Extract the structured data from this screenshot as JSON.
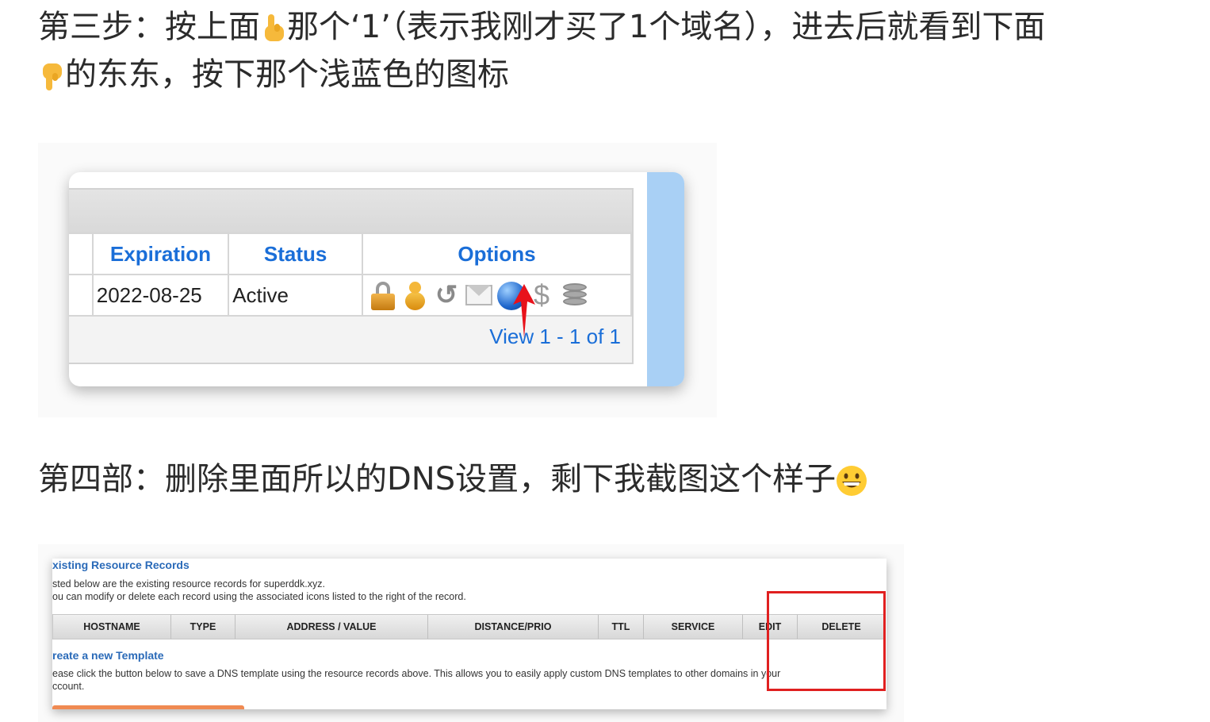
{
  "step3": {
    "part1": "第三步：按上面",
    "part2": "那个‘1’（表示我刚才买了1个域名），进去后就看到下面",
    "part3": "的东东，按下那个浅蓝色的图标"
  },
  "step4": {
    "text": "第四部：删除里面所以的DNS设置，剩下我截图这个样子"
  },
  "screenshot1": {
    "headers": [
      "Expiration",
      "Status",
      "Options"
    ],
    "row": {
      "expiration": "2022-08-25",
      "status": "Active"
    },
    "icons": [
      "lock-icon",
      "user-icon",
      "return-icon",
      "mail-icon",
      "globe-icon",
      "dollar-icon",
      "database-icon"
    ],
    "dollar_glyph": "$",
    "return_glyph": "↺",
    "view_text": "View 1 - 1 of 1"
  },
  "screenshot2": {
    "title": "xisting Resource Records",
    "line1": "sted below are the existing resource records for superddk.xyz.",
    "line2": "ou can modify or delete each record using the associated icons listed to the right of the record.",
    "columns": [
      "HOSTNAME",
      "TYPE",
      "ADDRESS / VALUE",
      "DISTANCE/PRIO",
      "TTL",
      "SERVICE",
      "EDIT",
      "DELETE"
    ],
    "create_link": "reate a new Template",
    "line3": "ease click the button below to save a DNS template using the resource records above. This allows you to easily apply custom DNS templates to other domains in your",
    "line4": "ccount."
  },
  "colors": {
    "link_blue": "#1a6ed8",
    "highlight_red": "#e02020",
    "accent_light_blue": "#a9d0f5"
  }
}
